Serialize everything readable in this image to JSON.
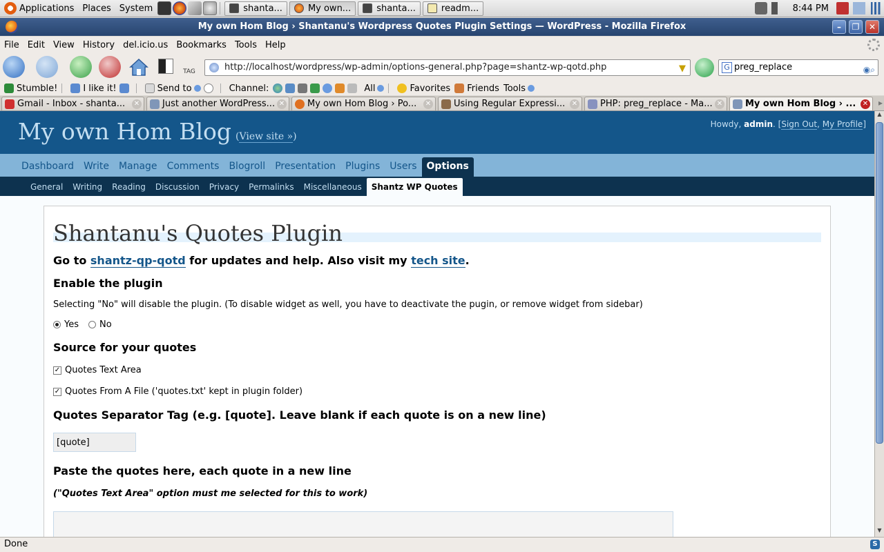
{
  "gnome_panel": {
    "menus": [
      "Applications",
      "Places",
      "System"
    ],
    "taskbar": [
      {
        "label": "shanta...",
        "active": false
      },
      {
        "label": "My own...",
        "active": true
      },
      {
        "label": "shanta...",
        "active": false
      },
      {
        "label": "readm...",
        "active": false
      }
    ],
    "clock": "8:44 PM"
  },
  "window": {
    "title": "My own Hom Blog › Shantanu's Wordpress Quotes Plugin Settings — WordPress - Mozilla Firefox"
  },
  "menubar": [
    "File",
    "Edit",
    "View",
    "History",
    "del.icio.us",
    "Bookmarks",
    "Tools",
    "Help"
  ],
  "toolbar": {
    "url": "http://localhost/wordpress/wp-admin/options-general.php?page=shantz-wp-qotd.php",
    "search_value": "preg_replace",
    "search_engine_icon": "G",
    "tag_label": "TAG"
  },
  "su_bar": {
    "stumble": "Stumble!",
    "ilike": "I like it!",
    "sendto": "Send to",
    "channel": "Channel:",
    "all": "All",
    "favorites": "Favorites",
    "friends": "Friends",
    "tools": "Tools"
  },
  "tabs": [
    {
      "label": "Gmail - Inbox - shanta...",
      "active": false
    },
    {
      "label": "Just another WordPress...",
      "active": false
    },
    {
      "label": "My own Hom Blog › Po...",
      "active": false
    },
    {
      "label": "Using Regular Expressi...",
      "active": false
    },
    {
      "label": "PHP: preg_replace - Ma...",
      "active": false
    },
    {
      "label": "My own Hom Blog › ...",
      "active": true
    }
  ],
  "wp": {
    "site_title": "My own Hom Blog",
    "view_site": "View site »",
    "howdy_prefix": "Howdy, ",
    "user": "admin",
    "sign_out": "Sign Out",
    "my_profile": "My Profile",
    "admin_menu": [
      "Dashboard",
      "Write",
      "Manage",
      "Comments",
      "Blogroll",
      "Presentation",
      "Plugins",
      "Users",
      "Options"
    ],
    "admin_menu_current": "Options",
    "sub_menu": [
      "General",
      "Writing",
      "Reading",
      "Discussion",
      "Privacy",
      "Permalinks",
      "Miscellaneous",
      "Shantz WP Quotes"
    ],
    "sub_menu_current": "Shantz WP Quotes"
  },
  "plugin": {
    "heading": "Shantanu's Quotes Plugin",
    "goto_prefix": "Go to ",
    "goto_link": "shantz-qp-qotd",
    "goto_middle": " for updates and help. Also visit my ",
    "tech_link": "tech site",
    "goto_suffix": ".",
    "enable_heading": "Enable the plugin",
    "enable_desc": "Selecting \"No\" will disable the plugin. (To disable widget as well, you have to deactivate the pugin, or remove widget from sidebar)",
    "yes_label": "Yes",
    "no_label": "No",
    "enabled": "Yes",
    "source_heading": "Source for your quotes",
    "source_text_area": "Quotes Text Area",
    "source_file": "Quotes From A File ('quotes.txt' kept in plugin folder)",
    "separator_heading": "Quotes Separator Tag (e.g. [quote]. Leave blank if each quote is on a new line)",
    "separator_value": "[quote]",
    "paste_heading": "Paste the quotes here, each quote in a new line",
    "paste_note": "(\"Quotes Text Area\" option must me selected for this to work)"
  },
  "status": "Done"
}
